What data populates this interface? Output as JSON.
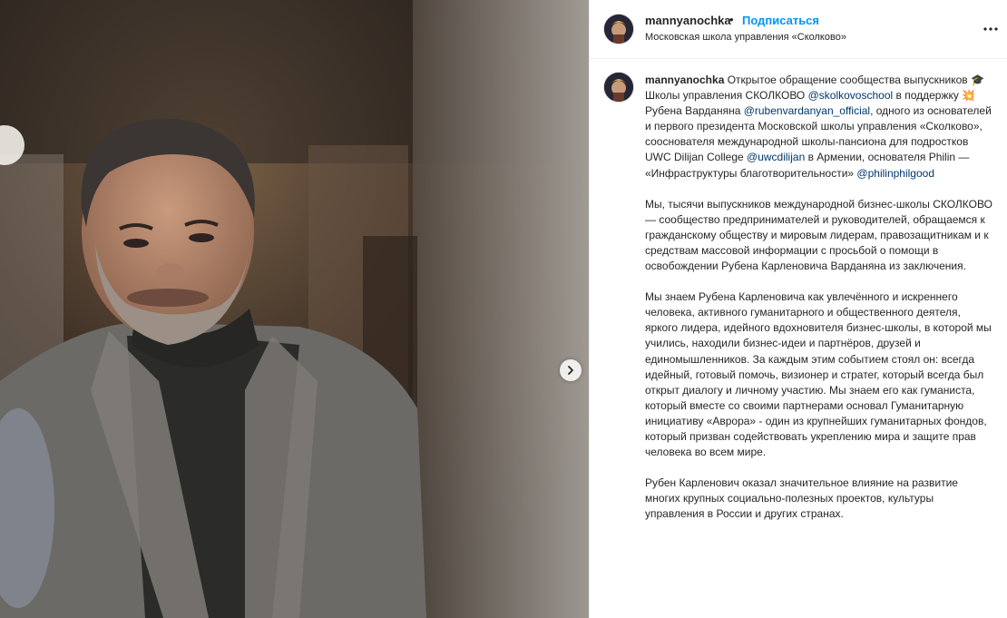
{
  "post": {
    "username": "mannyanochka",
    "separator": "•",
    "follow_label": "Подписаться",
    "location": "Московская школа управления «Сколково»",
    "more_icon": "more-options-icon",
    "next_icon": "chevron-right-icon"
  },
  "caption": {
    "username": "mannyanochka",
    "p1": {
      "t1": "Открытое обращение сообщества выпускников ",
      "emoji1": "🎓",
      "t2": " Школы управления СКОЛКОВО ",
      "tag1": "@skolkovoschool",
      "t3": " в поддержку ",
      "emoji2": "💥",
      "t4": " Рубена Варданяна ",
      "tag2": "@rubenvardanyan_official",
      "t5": ", одного из основателей и первого президента Московской школы управления «Сколково», сооснователя международной школы-пансиона для подростков UWC Dilijan College ",
      "tag3": "@uwcdilijan",
      "t6": " в Армении, основателя Philin — «Инфраструктуры благотворительности» ",
      "tag4": "@philinphilgood"
    },
    "p2": "Мы, тысячи выпускников международной бизнес-школы СКОЛКОВО — сообщество предпринимателей и руководителей, обращаемся к гражданскому обществу и мировым лидерам, правозащитникам и к средствам массовой информации с просьбой о помощи в освобождении Рубена Карленовича Варданяна из заключения.",
    "p3": "Мы знаем Рубена Карленовича как увлечённого и искреннего человека, активного гуманитарного и общественного деятеля, яркого лидера, идейного вдохновителя бизнес-школы, в которой мы учились, находили бизнес-идеи и партнёров, друзей и единомышленников. За каждым этим событием стоял он: всегда идейный, готовый помочь, визионер и стратег, который всегда был открыт диалогу и личному участию. Мы знаем его как гуманиста, который вместе со своими партнерами основал Гуманитарную инициативу «Аврора» - один из крупнейших гуманитарных фондов, который призван содействовать укреплению мира и защите прав человека во всем мире.",
    "p4": "Рубен Карленович оказал значительное влияние на развитие многих крупных социально-полезных проектов, культуры управления в России и других странах."
  },
  "colors": {
    "link": "#00376b",
    "follow": "#0095f6",
    "text": "#262626"
  }
}
